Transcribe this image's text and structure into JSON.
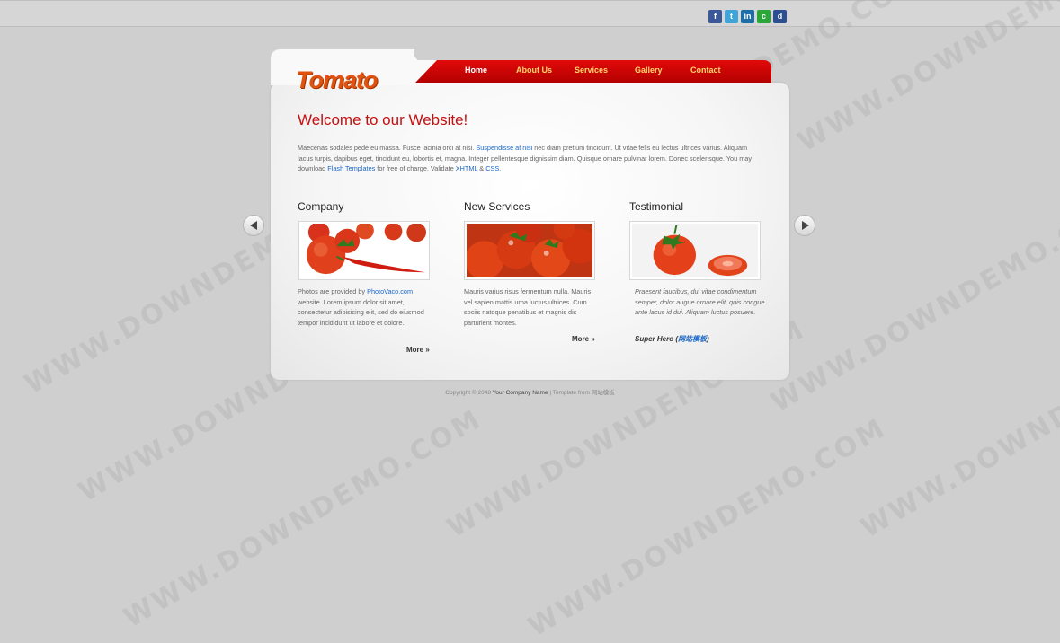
{
  "social_icons": [
    {
      "name": "facebook-icon",
      "glyph": "f",
      "color": "#3b5998"
    },
    {
      "name": "twitter-icon",
      "glyph": "t",
      "color": "#3fa5d9"
    },
    {
      "name": "linkedin-icon",
      "glyph": "in",
      "color": "#1d6ea6"
    },
    {
      "name": "stumbleupon-icon",
      "glyph": "c",
      "color": "#2aa63a"
    },
    {
      "name": "delicious-icon",
      "glyph": "d",
      "color": "#2c4f8f"
    }
  ],
  "logo": "Tomato",
  "nav": {
    "home": "Home",
    "about": "About Us",
    "services": "Services",
    "gallery": "Gallery",
    "contact": "Contact"
  },
  "welcome_title": "Welcome to our Website!",
  "intro": {
    "part1": "Maecenas sodales pede eu massa. Fusce lacinia orci at nisi. ",
    "link1": "Suspendisse at nisi",
    "part2": " nec diam pretium tincidunt. Ut vitae felis eu lectus ultrices varius. Aliquam lacus turpis, dapibus eget, tincidunt eu, lobortis et, magna. Integer pellentesque dignissim diam. Quisque ornare pulvinar lorem. Donec scelerisque. You may download ",
    "link2": "Flash Templates",
    "part3": " for free of charge. Validate ",
    "link3": "XHTML",
    "part4": " & ",
    "link4": "CSS",
    "part5": "."
  },
  "company": {
    "title": "Company",
    "text1": "Photos are provided by ",
    "link": "PhotoVaco.com",
    "text2": " website. Lorem ipsum dolor sit amet, consectetur adipisicing elit, sed do eiusmod tempor incididunt ut labore et dolore.",
    "more": "More »"
  },
  "services": {
    "title": "New Services",
    "text": "Mauris varius risus fermentum nulla. Mauris vel sapien mattis urna luctus ultrices. Cum sociis natoque penatibus et magnis dis parturient montes.",
    "more": "More »"
  },
  "testimonial": {
    "title": "Testimonial",
    "text": "Praesent faucibus, dui vitae condimentum semper, dolor augue ornare elit, quis congue ante lacus id dui. Aliquam luctus posuere.",
    "author": "Super Hero",
    "author_open": " (",
    "author_link": "网站模板",
    "author_close": ")"
  },
  "footer": {
    "copyright": "Copyright © 2048 ",
    "company": "Your Company Name",
    "sep": " | Template from ",
    "source": "网站模板"
  },
  "watermark": "WWW.DOWNDEMO.COM"
}
